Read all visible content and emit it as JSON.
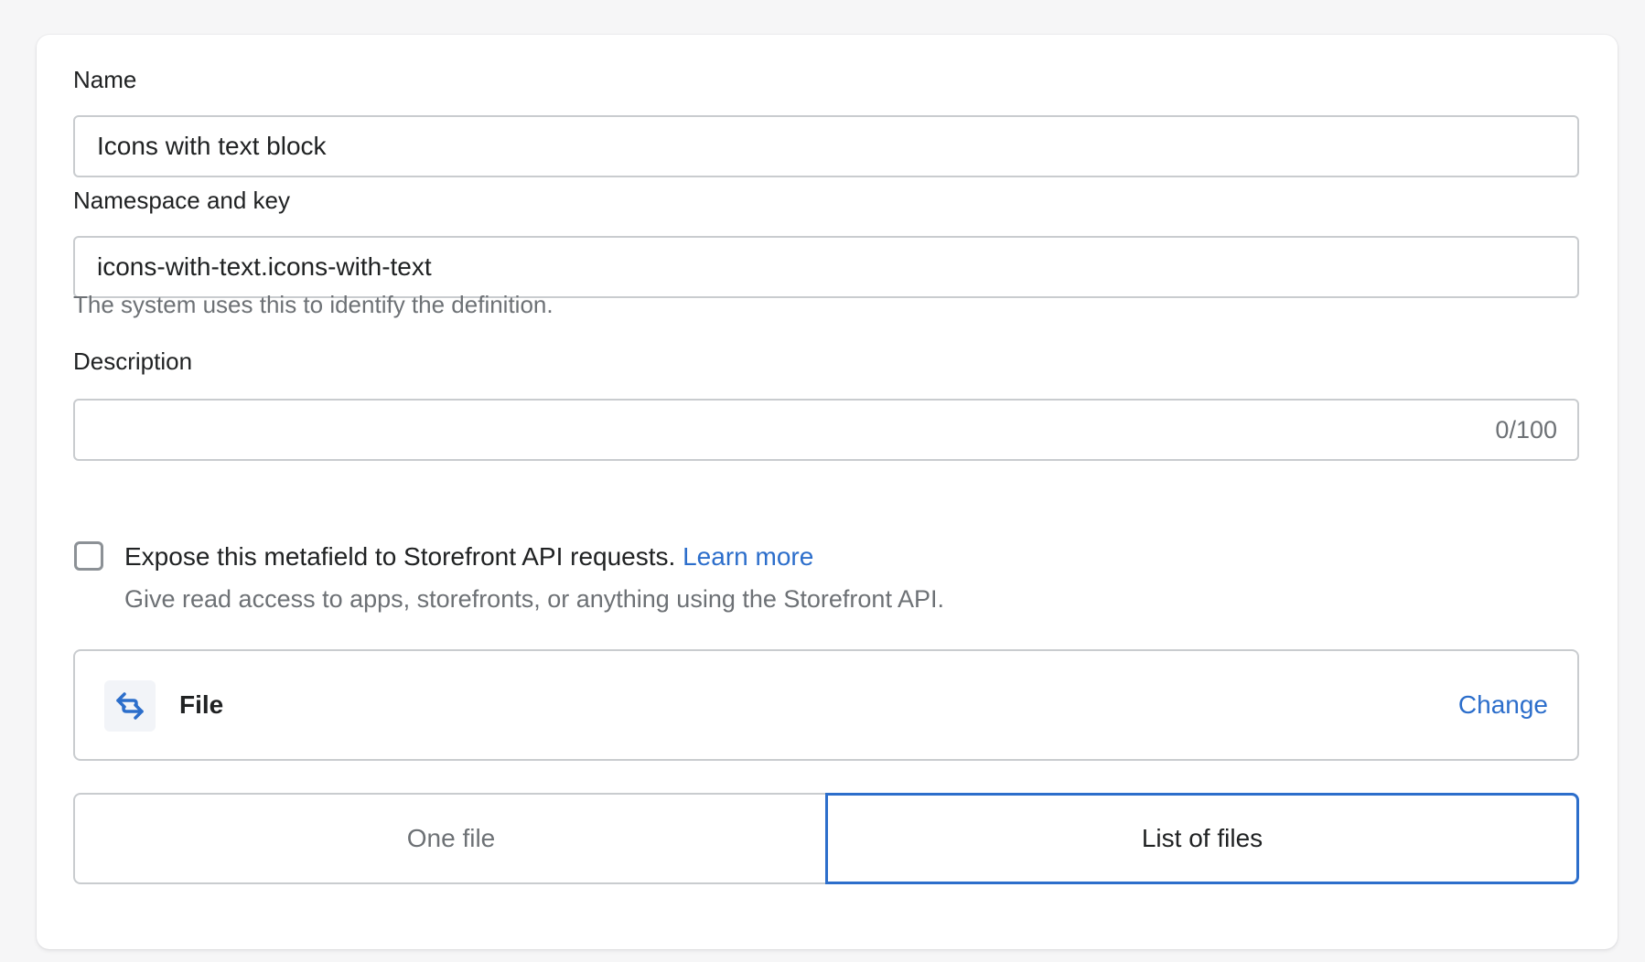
{
  "form": {
    "name": {
      "label": "Name",
      "value": "Icons with text block"
    },
    "namespace_key": {
      "label": "Namespace and key",
      "value": "icons-with-text.icons-with-text",
      "help_text": "The system uses this to identify the definition."
    },
    "description": {
      "label": "Description",
      "value": "",
      "counter": "0/100"
    },
    "storefront_access": {
      "checked": false,
      "label": "Expose this metafield to Storefront API requests.",
      "link_text": "Learn more",
      "help_text": "Give read access to apps, storefronts, or anything using the Storefront API."
    },
    "content_type": {
      "icon": "swap-arrows-icon",
      "name": "File",
      "change_label": "Change"
    },
    "cardinality": {
      "options": [
        "One file",
        "List of files"
      ],
      "selected": "List of files"
    }
  },
  "colors": {
    "accent": "#2c6ecb",
    "border": "#c9cccf",
    "subdued_text": "#6d7175",
    "text": "#202223",
    "page_background": "#f6f6f7"
  }
}
